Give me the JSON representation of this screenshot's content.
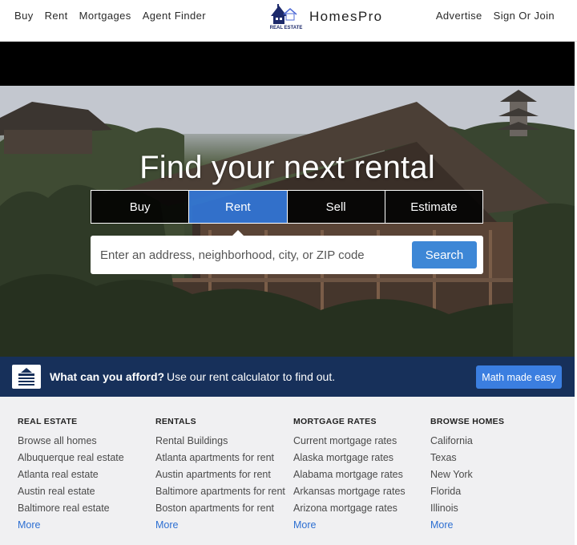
{
  "header": {
    "nav_left": [
      "Buy",
      "Rent",
      "Mortgages",
      "Agent Finder"
    ],
    "brand": {
      "logo_text": "REAL ESTATE",
      "name": "HomesPro"
    },
    "nav_right": [
      "Advertise",
      "Sign Or Join"
    ]
  },
  "hero": {
    "title": "Find your next rental",
    "tabs": [
      "Buy",
      "Rent",
      "Sell",
      "Estimate"
    ],
    "active_tab": "Rent",
    "search": {
      "placeholder": "Enter an address, neighborhood, city, or ZIP code",
      "button": "Search"
    }
  },
  "promo": {
    "strong": "What can you afford?",
    "text": "Use our rent calculator to find out.",
    "button": "Math made easy"
  },
  "footer": {
    "columns": [
      {
        "title": "REAL ESTATE",
        "links": [
          "Browse all homes",
          "Albuquerque real estate",
          "Atlanta real estate",
          "Austin real estate",
          "Baltimore real estate"
        ],
        "more": "More"
      },
      {
        "title": "RENTALS",
        "links": [
          "Rental Buildings",
          "Atlanta apartments for rent",
          "Austin apartments for rent",
          "Baltimore apartments for rent",
          "Boston apartments for rent"
        ],
        "more": "More"
      },
      {
        "title": "MORTGAGE RATES",
        "links": [
          "Current mortgage rates",
          "Alaska mortgage rates",
          "Alabama mortgage rates",
          "Arkansas mortgage rates",
          "Arizona mortgage rates"
        ],
        "more": "More"
      },
      {
        "title": "BROWSE HOMES",
        "links": [
          "California",
          "Texas",
          "New York",
          "Florida",
          "Illinois"
        ],
        "more": "More"
      }
    ]
  },
  "colors": {
    "accent_blue": "#3d87d6",
    "promo_bg": "#17305a",
    "link_blue": "#2d6fd2",
    "footer_bg": "#f0f0f2"
  }
}
